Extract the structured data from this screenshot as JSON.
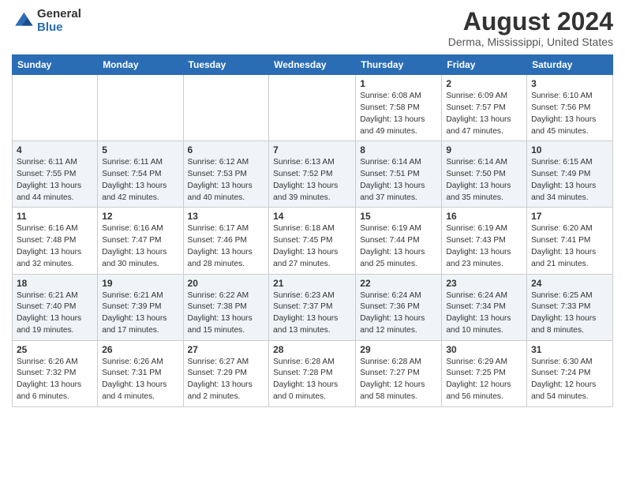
{
  "header": {
    "logo_general": "General",
    "logo_blue": "Blue",
    "main_title": "August 2024",
    "subtitle": "Derma, Mississippi, United States"
  },
  "calendar": {
    "days_of_week": [
      "Sunday",
      "Monday",
      "Tuesday",
      "Wednesday",
      "Thursday",
      "Friday",
      "Saturday"
    ],
    "weeks": [
      [
        {
          "num": "",
          "detail": ""
        },
        {
          "num": "",
          "detail": ""
        },
        {
          "num": "",
          "detail": ""
        },
        {
          "num": "",
          "detail": ""
        },
        {
          "num": "1",
          "detail": "Sunrise: 6:08 AM\nSunset: 7:58 PM\nDaylight: 13 hours\nand 49 minutes."
        },
        {
          "num": "2",
          "detail": "Sunrise: 6:09 AM\nSunset: 7:57 PM\nDaylight: 13 hours\nand 47 minutes."
        },
        {
          "num": "3",
          "detail": "Sunrise: 6:10 AM\nSunset: 7:56 PM\nDaylight: 13 hours\nand 45 minutes."
        }
      ],
      [
        {
          "num": "4",
          "detail": "Sunrise: 6:11 AM\nSunset: 7:55 PM\nDaylight: 13 hours\nand 44 minutes."
        },
        {
          "num": "5",
          "detail": "Sunrise: 6:11 AM\nSunset: 7:54 PM\nDaylight: 13 hours\nand 42 minutes."
        },
        {
          "num": "6",
          "detail": "Sunrise: 6:12 AM\nSunset: 7:53 PM\nDaylight: 13 hours\nand 40 minutes."
        },
        {
          "num": "7",
          "detail": "Sunrise: 6:13 AM\nSunset: 7:52 PM\nDaylight: 13 hours\nand 39 minutes."
        },
        {
          "num": "8",
          "detail": "Sunrise: 6:14 AM\nSunset: 7:51 PM\nDaylight: 13 hours\nand 37 minutes."
        },
        {
          "num": "9",
          "detail": "Sunrise: 6:14 AM\nSunset: 7:50 PM\nDaylight: 13 hours\nand 35 minutes."
        },
        {
          "num": "10",
          "detail": "Sunrise: 6:15 AM\nSunset: 7:49 PM\nDaylight: 13 hours\nand 34 minutes."
        }
      ],
      [
        {
          "num": "11",
          "detail": "Sunrise: 6:16 AM\nSunset: 7:48 PM\nDaylight: 13 hours\nand 32 minutes."
        },
        {
          "num": "12",
          "detail": "Sunrise: 6:16 AM\nSunset: 7:47 PM\nDaylight: 13 hours\nand 30 minutes."
        },
        {
          "num": "13",
          "detail": "Sunrise: 6:17 AM\nSunset: 7:46 PM\nDaylight: 13 hours\nand 28 minutes."
        },
        {
          "num": "14",
          "detail": "Sunrise: 6:18 AM\nSunset: 7:45 PM\nDaylight: 13 hours\nand 27 minutes."
        },
        {
          "num": "15",
          "detail": "Sunrise: 6:19 AM\nSunset: 7:44 PM\nDaylight: 13 hours\nand 25 minutes."
        },
        {
          "num": "16",
          "detail": "Sunrise: 6:19 AM\nSunset: 7:43 PM\nDaylight: 13 hours\nand 23 minutes."
        },
        {
          "num": "17",
          "detail": "Sunrise: 6:20 AM\nSunset: 7:41 PM\nDaylight: 13 hours\nand 21 minutes."
        }
      ],
      [
        {
          "num": "18",
          "detail": "Sunrise: 6:21 AM\nSunset: 7:40 PM\nDaylight: 13 hours\nand 19 minutes."
        },
        {
          "num": "19",
          "detail": "Sunrise: 6:21 AM\nSunset: 7:39 PM\nDaylight: 13 hours\nand 17 minutes."
        },
        {
          "num": "20",
          "detail": "Sunrise: 6:22 AM\nSunset: 7:38 PM\nDaylight: 13 hours\nand 15 minutes."
        },
        {
          "num": "21",
          "detail": "Sunrise: 6:23 AM\nSunset: 7:37 PM\nDaylight: 13 hours\nand 13 minutes."
        },
        {
          "num": "22",
          "detail": "Sunrise: 6:24 AM\nSunset: 7:36 PM\nDaylight: 13 hours\nand 12 minutes."
        },
        {
          "num": "23",
          "detail": "Sunrise: 6:24 AM\nSunset: 7:34 PM\nDaylight: 13 hours\nand 10 minutes."
        },
        {
          "num": "24",
          "detail": "Sunrise: 6:25 AM\nSunset: 7:33 PM\nDaylight: 13 hours\nand 8 minutes."
        }
      ],
      [
        {
          "num": "25",
          "detail": "Sunrise: 6:26 AM\nSunset: 7:32 PM\nDaylight: 13 hours\nand 6 minutes."
        },
        {
          "num": "26",
          "detail": "Sunrise: 6:26 AM\nSunset: 7:31 PM\nDaylight: 13 hours\nand 4 minutes."
        },
        {
          "num": "27",
          "detail": "Sunrise: 6:27 AM\nSunset: 7:29 PM\nDaylight: 13 hours\nand 2 minutes."
        },
        {
          "num": "28",
          "detail": "Sunrise: 6:28 AM\nSunset: 7:28 PM\nDaylight: 13 hours\nand 0 minutes."
        },
        {
          "num": "29",
          "detail": "Sunrise: 6:28 AM\nSunset: 7:27 PM\nDaylight: 12 hours\nand 58 minutes."
        },
        {
          "num": "30",
          "detail": "Sunrise: 6:29 AM\nSunset: 7:25 PM\nDaylight: 12 hours\nand 56 minutes."
        },
        {
          "num": "31",
          "detail": "Sunrise: 6:30 AM\nSunset: 7:24 PM\nDaylight: 12 hours\nand 54 minutes."
        }
      ]
    ]
  }
}
